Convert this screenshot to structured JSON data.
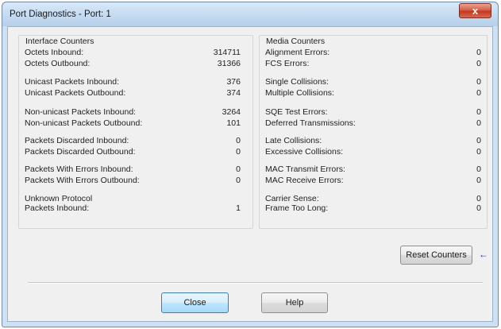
{
  "window": {
    "title": "Port Diagnostics -  Port: 1",
    "close_glyph": "x"
  },
  "interface": {
    "title": "Interface Counters",
    "rows": [
      {
        "label": "Octets Inbound:",
        "value": "314711"
      },
      {
        "label": "Octets Outbound:",
        "value": "31366"
      },
      {
        "label": "Unicast Packets Inbound:",
        "value": "376"
      },
      {
        "label": "Unicast Packets Outbound:",
        "value": "374"
      },
      {
        "label": "Non-unicast Packets Inbound:",
        "value": "3264"
      },
      {
        "label": "Non-unicast Packets Outbound:",
        "value": "101"
      },
      {
        "label": "Packets Discarded Inbound:",
        "value": "0"
      },
      {
        "label": "Packets Discarded Outbound:",
        "value": "0"
      },
      {
        "label": "Packets With Errors Inbound:",
        "value": "0"
      },
      {
        "label": "Packets With Errors Outbound:",
        "value": "0"
      },
      {
        "label": "Unknown Protocol",
        "value": ""
      },
      {
        "label": "Packets Inbound:",
        "value": "1"
      }
    ]
  },
  "media": {
    "title": "Media Counters",
    "rows": [
      {
        "label": "Alignment Errors:",
        "value": "0"
      },
      {
        "label": "FCS Errors:",
        "value": "0"
      },
      {
        "label": "Single Collisions:",
        "value": "0"
      },
      {
        "label": "Multiple Collisions:",
        "value": "0"
      },
      {
        "label": "SQE Test Errors:",
        "value": "0"
      },
      {
        "label": "Deferred Transmissions:",
        "value": "0"
      },
      {
        "label": "Late Collisions:",
        "value": "0"
      },
      {
        "label": "Excessive Collisions:",
        "value": "0"
      },
      {
        "label": "MAC Transmit Errors:",
        "value": "0"
      },
      {
        "label": "MAC Receive Errors:",
        "value": "0"
      },
      {
        "label": "Carrier Sense:",
        "value": "0"
      },
      {
        "label": "Frame Too Long:",
        "value": "0"
      }
    ]
  },
  "buttons": {
    "reset": "Reset Counters",
    "close": "Close",
    "help": "Help"
  },
  "arrow_glyph": "←",
  "colors": {
    "title_gradient": "#c4daf1",
    "close_red": "#c2391f",
    "client_bg": "#f0f0f0"
  }
}
